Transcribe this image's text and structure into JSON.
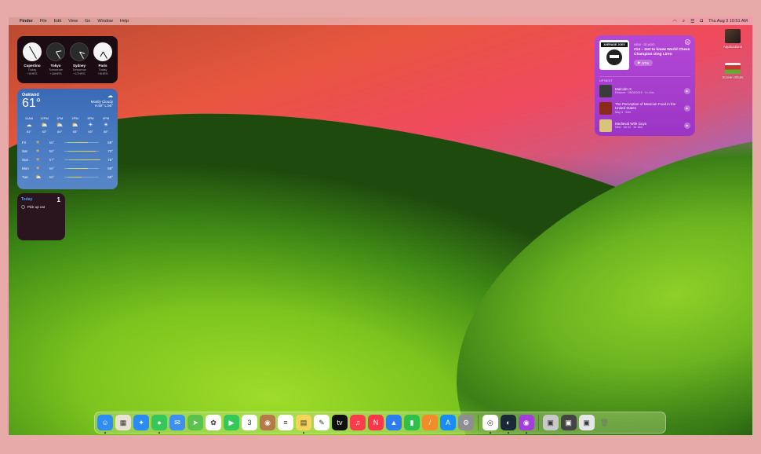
{
  "menubar": {
    "app_name": "Finder",
    "items": [
      "File",
      "Edit",
      "View",
      "Go",
      "Window",
      "Help"
    ],
    "clock": "Thu Aug 3  10:51 AM"
  },
  "world_clock": [
    {
      "city": "Cupertino",
      "day": "Today",
      "offset": "+0HRS"
    },
    {
      "city": "Tokyo",
      "day": "Tomorrow",
      "offset": "+16HRS"
    },
    {
      "city": "Sydney",
      "day": "Tomorrow",
      "offset": "+17HRS"
    },
    {
      "city": "Paris",
      "day": "Today",
      "offset": "+9HRS"
    }
  ],
  "weather": {
    "city": "Oakland",
    "temp": "61°",
    "condition": "Mostly Cloudy",
    "hilo": "H:69° L:56°",
    "hourly": [
      {
        "time": "11AM",
        "temp": "61°"
      },
      {
        "time": "12PM",
        "temp": "63°"
      },
      {
        "time": "1PM",
        "temp": "64°"
      },
      {
        "time": "2PM",
        "temp": "65°"
      },
      {
        "time": "3PM",
        "temp": "65°"
      },
      {
        "time": "4PM",
        "temp": "65°"
      }
    ],
    "daily": [
      {
        "day": "Fri",
        "low": "56°",
        "high": "69°"
      },
      {
        "day": "Sat",
        "low": "56°",
        "high": "73°"
      },
      {
        "day": "Sun",
        "low": "57°",
        "high": "75°"
      },
      {
        "day": "Mon",
        "low": "56°",
        "high": "69°"
      },
      {
        "day": "Tue",
        "low": "56°",
        "high": "65°"
      }
    ]
  },
  "reminders": {
    "title": "Today",
    "count": "1",
    "items": [
      "Pick up cat"
    ]
  },
  "podcasts": {
    "art_label": "AVERAGE JOES",
    "new_label": "NEW · 2D AGO",
    "episode_title": "#14 – Get to know World Chess Champion Ding Liren",
    "duration": "57m",
    "up_next_label": "UP NEXT",
    "episodes": [
      {
        "title": "Malcolm X",
        "meta": "Resume · 08/06/2019 · 1h 44m",
        "color": "#3b3b3b"
      },
      {
        "title": "The Perception of Mexican Food in the United States",
        "meta": "May 4 · 34m",
        "color": "#8a2a1a"
      },
      {
        "title": "Medieval Wife Guys",
        "meta": "New · Jul 31 · 1h 16m",
        "color": "#d9c47a"
      }
    ]
  },
  "desktop_icons": [
    {
      "label": "Applications"
    },
    {
      "label": "Screen Shots"
    }
  ],
  "dock": {
    "apps": [
      {
        "name": "finder-icon",
        "glyph": "☺",
        "color": "#2f8cf0",
        "running": true
      },
      {
        "name": "launchpad-icon",
        "glyph": "▦",
        "color": "#e9e3d6",
        "running": false
      },
      {
        "name": "safari-icon",
        "glyph": "✦",
        "color": "#2a8cf2",
        "running": false
      },
      {
        "name": "messages-icon",
        "glyph": "●",
        "color": "#35c759",
        "running": true
      },
      {
        "name": "mail-icon",
        "glyph": "✉",
        "color": "#3d8ff0",
        "running": false
      },
      {
        "name": "maps-icon",
        "glyph": "➤",
        "color": "#5bc24e",
        "running": false
      },
      {
        "name": "photos-icon",
        "glyph": "✿",
        "color": "#ffffff",
        "running": false
      },
      {
        "name": "facetime-icon",
        "glyph": "▶",
        "color": "#34c759",
        "running": false
      },
      {
        "name": "calendar-icon",
        "glyph": "3",
        "color": "#ffffff",
        "running": false
      },
      {
        "name": "contacts-icon",
        "glyph": "◉",
        "color": "#b47a4a",
        "running": false
      },
      {
        "name": "reminders-icon",
        "glyph": "≡",
        "color": "#ffffff",
        "running": false
      },
      {
        "name": "notes-icon",
        "glyph": "▤",
        "color": "#f5d45a",
        "running": true
      },
      {
        "name": "freeform-icon",
        "glyph": "✎",
        "color": "#ffffff",
        "running": false
      },
      {
        "name": "appletv-icon",
        "glyph": "tv",
        "color": "#111111",
        "running": false
      },
      {
        "name": "music-icon",
        "glyph": "♫",
        "color": "#fa3c4c",
        "running": false
      },
      {
        "name": "news-icon",
        "glyph": "N",
        "color": "#f8384a",
        "running": false
      },
      {
        "name": "keynote-icon",
        "glyph": "▲",
        "color": "#2b7df0",
        "running": false
      },
      {
        "name": "numbers-icon",
        "glyph": "▮",
        "color": "#2fbf4a",
        "running": false
      },
      {
        "name": "pages-icon",
        "glyph": "/",
        "color": "#f28c28",
        "running": false
      },
      {
        "name": "appstore-icon",
        "glyph": "A",
        "color": "#1a8cf5",
        "running": false
      },
      {
        "name": "settings-icon",
        "glyph": "⚙",
        "color": "#8e8e93",
        "running": false
      },
      {
        "name": "chrome-icon",
        "glyph": "◎",
        "color": "#ffffff",
        "running": true
      },
      {
        "name": "steam-icon",
        "glyph": "◐",
        "color": "#1b2838",
        "running": true
      },
      {
        "name": "podcasts-icon",
        "glyph": "◉",
        "color": "#a23fd8",
        "running": true
      },
      {
        "name": "downloads-stack-icon",
        "glyph": "▣",
        "color": "#c9c9c9",
        "running": false
      },
      {
        "name": "screenshots-stack-icon",
        "glyph": "▣",
        "color": "#444444",
        "running": false
      },
      {
        "name": "documents-stack-icon",
        "glyph": "▣",
        "color": "#e6e6e6",
        "running": false
      },
      {
        "name": "trash-icon",
        "glyph": "🗑",
        "color": "#9a9a9a",
        "running": false
      }
    ]
  }
}
